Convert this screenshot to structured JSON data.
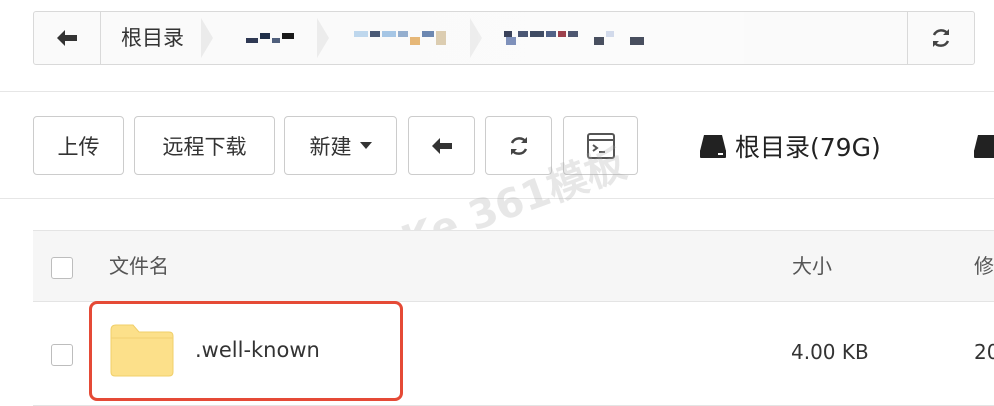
{
  "breadcrumb": {
    "root_label": "根目录"
  },
  "toolbar": {
    "upload_label": "上传",
    "remote_download_label": "远程下载",
    "new_label": "新建",
    "disk_label": "根目录(79G)"
  },
  "watermark": {
    "text": "Ke 361模板"
  },
  "table": {
    "columns": [
      "文件名",
      "大小",
      "修"
    ],
    "rows": [
      {
        "name": ".well-known",
        "size": "4.00 KB",
        "date": "20"
      }
    ]
  },
  "colors": {
    "highlight": "#e54a36",
    "folder": "#fce08a",
    "border": "#cccccc"
  },
  "icons": {
    "back": "arrow-left-icon",
    "refresh": "refresh-icon",
    "terminal": "terminal-icon",
    "disk": "hard-drive-icon",
    "folder": "folder-icon",
    "dropdown": "caret-down-icon"
  }
}
